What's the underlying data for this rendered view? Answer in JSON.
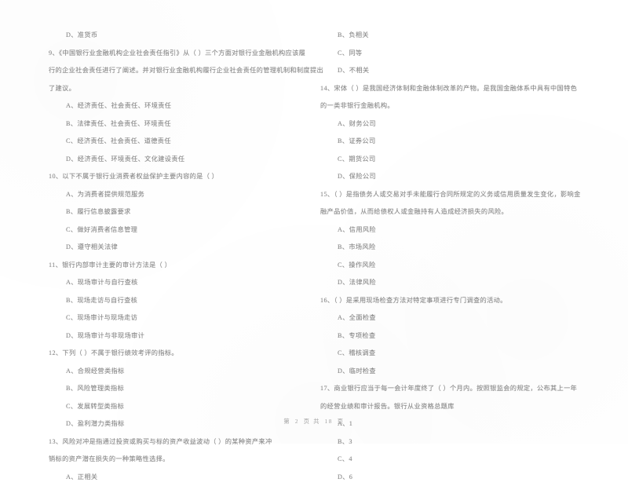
{
  "document": {
    "type": "exam-question-paper",
    "language": "zh-CN",
    "footer": {
      "prefix": "第",
      "page_number": "2",
      "middle": "页  共",
      "total_pages": "18",
      "suffix": "页",
      "full_text": "第 2 页 共 18 页"
    }
  },
  "left_column": {
    "lines": [
      {
        "kind": "choice",
        "text": "D、准货币"
      },
      {
        "kind": "question",
        "text": "9、《中国银行业金融机构企业社会责任指引》从（        ）三个方面对银行业金融机构应该履"
      },
      {
        "kind": "cont",
        "text": "行的企业社会责任进行了阐述。并对银行业金融机构履行企业社会责任的管理机制和制度提出"
      },
      {
        "kind": "cont",
        "text": "了建议。"
      },
      {
        "kind": "choice",
        "text": "A、经济责任、社会责任、环境责任"
      },
      {
        "kind": "choice",
        "text": "B、法律责任、社会责任、环境责任"
      },
      {
        "kind": "choice",
        "text": "C、经济责任、社会责任、道德责任"
      },
      {
        "kind": "choice",
        "text": "D、经济责任、环境责任、文化建设责任"
      },
      {
        "kind": "question",
        "text": "10、以下不属于银行业消费者权益保护主要内容的是（        ）"
      },
      {
        "kind": "choice",
        "text": "A、为消费者提供规范服务"
      },
      {
        "kind": "choice",
        "text": "B、履行信息披露要求"
      },
      {
        "kind": "choice",
        "text": "C、做好消费者信息管理"
      },
      {
        "kind": "choice",
        "text": "D、遵守相关法律"
      },
      {
        "kind": "question",
        "text": "11、银行内部审计主要的审计方法是（        ）"
      },
      {
        "kind": "choice",
        "text": "A、现场审计与自行查核"
      },
      {
        "kind": "choice",
        "text": "B、现场走访与自行查核"
      },
      {
        "kind": "choice",
        "text": "C、现场审计与现场走访"
      },
      {
        "kind": "choice",
        "text": "D、现场审计与非现场审计"
      },
      {
        "kind": "question",
        "text": "12、下列（        ）不属于银行绩效考评的指标。"
      },
      {
        "kind": "choice",
        "text": "A、合规经营类指标"
      },
      {
        "kind": "choice",
        "text": "B、风险管理类指标"
      },
      {
        "kind": "choice",
        "text": "C、发展转型类指标"
      },
      {
        "kind": "choice",
        "text": "D、盈利潜力类指标"
      },
      {
        "kind": "question",
        "text": "13、风险对冲是指通过投资或购买与标的资产收益波动（        ）的某种资产来冲"
      },
      {
        "kind": "cont",
        "text": "销标的资产潜在损失的一种策略性选择。"
      },
      {
        "kind": "choice",
        "text": "A、正相关"
      }
    ]
  },
  "right_column": {
    "lines": [
      {
        "kind": "choice",
        "text": "B、负相关"
      },
      {
        "kind": "choice",
        "text": "C、同等"
      },
      {
        "kind": "choice",
        "text": "D、不相关"
      },
      {
        "kind": "question",
        "text": "14、宋体（        ）是我国经济体制和金融体制改革的产物。是我国金融体系中具有中国特色"
      },
      {
        "kind": "cont",
        "text": "的一类非银行金融机构。"
      },
      {
        "kind": "choice",
        "text": "A、财务公司"
      },
      {
        "kind": "choice",
        "text": "B、证券公司"
      },
      {
        "kind": "choice",
        "text": "C、期货公司"
      },
      {
        "kind": "choice",
        "text": "D、保险公司"
      },
      {
        "kind": "question",
        "text": "15、（        ）是指债务人或交易对手未能履行合同所规定的义务或信用质量发生变化，影响金"
      },
      {
        "kind": "cont",
        "text": "融产品价值，从而给债权人或金融持有人造成经济损失的风险。"
      },
      {
        "kind": "choice",
        "text": "A、信用风险"
      },
      {
        "kind": "choice",
        "text": "B、市场风险"
      },
      {
        "kind": "choice",
        "text": "C、操作风险"
      },
      {
        "kind": "choice",
        "text": "D、法律风险"
      },
      {
        "kind": "question",
        "text": "16、（        ）是采用现场检查方法对特定事项进行专门调查的活动。"
      },
      {
        "kind": "choice",
        "text": "A、全面检查"
      },
      {
        "kind": "choice",
        "text": "B、专项检查"
      },
      {
        "kind": "choice",
        "text": "C、稽核调查"
      },
      {
        "kind": "choice",
        "text": "D、临时检查"
      },
      {
        "kind": "question",
        "text": "17、商业银行应当于每一会计年度终了（        ）个月内。按照银监会的规定，公布其上一年"
      },
      {
        "kind": "cont",
        "text": "的经营业绩和审计报告。银行从业资格总题库"
      },
      {
        "kind": "choice",
        "text": "A、1"
      },
      {
        "kind": "choice",
        "text": "B、3"
      },
      {
        "kind": "choice",
        "text": "C、4"
      },
      {
        "kind": "choice",
        "text": "D、6"
      }
    ]
  }
}
